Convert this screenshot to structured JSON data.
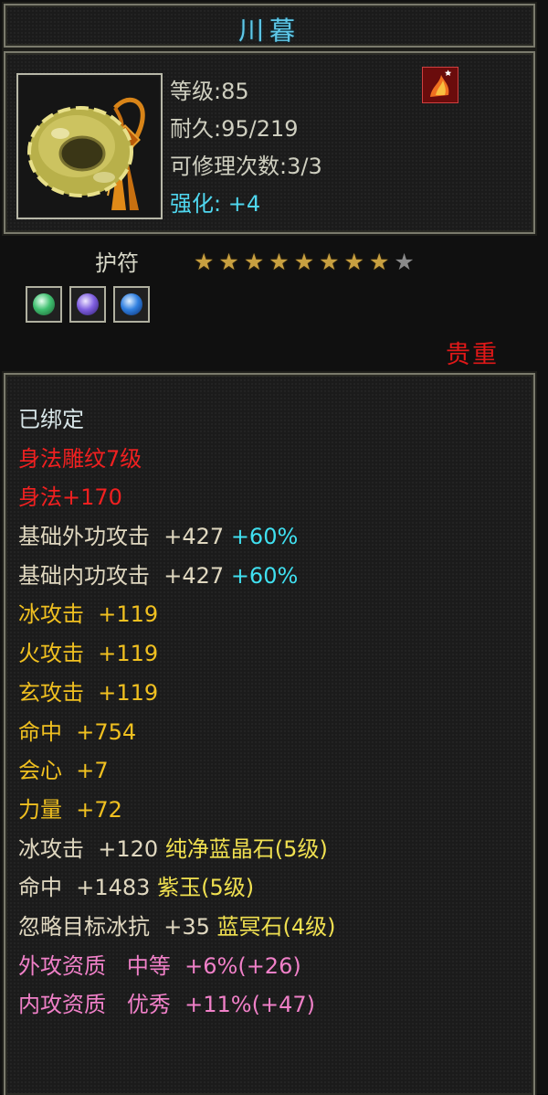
{
  "item": {
    "name": "川暮",
    "level_text": "等级:85",
    "durability_text": "耐久:95/219",
    "repair_text": "可修理次数:3/3",
    "enhance_label": "强化:",
    "enhance_value": "+4",
    "type": "护符",
    "stars_total": 9,
    "stars_lit": 8,
    "rarity": "贵重",
    "gems": [
      "green-gem-icon",
      "purple-gem-icon",
      "blue-gem-icon"
    ]
  },
  "attributes": {
    "bound": "已绑定",
    "engrave": "身法雕纹7级",
    "agility": "身法+170",
    "ext_attack": {
      "label": "基础外功攻击  +427 ",
      "pct": "+60%"
    },
    "int_attack": {
      "label": "基础内功攻击  +427 ",
      "pct": "+60%"
    },
    "ice_attack": "冰攻击  +119",
    "fire_attack": "火攻击  +119",
    "mystic_attack": "玄攻击  +119",
    "hit": "命中  +754",
    "crit": "会心  +7",
    "strength": "力量  +72",
    "gem1": {
      "stat": "冰攻击  +120 ",
      "gem": "纯净蓝晶石(5级)"
    },
    "gem2": {
      "stat": "命中  +1483 ",
      "gem": "紫玉(5级)"
    },
    "gem3": {
      "stat": "忽略目标冰抗  +35 ",
      "gem": "蓝冥石(4级)"
    },
    "aptitude_ext": "外攻资质   中等  +6%(+26)",
    "aptitude_int": "内攻资质   优秀  +11%(+47)"
  },
  "colors": {
    "title": "#5fc8e8",
    "rarity": "#e01818",
    "star_lit": "#c8a040",
    "star_off": "#8a8a8a"
  }
}
